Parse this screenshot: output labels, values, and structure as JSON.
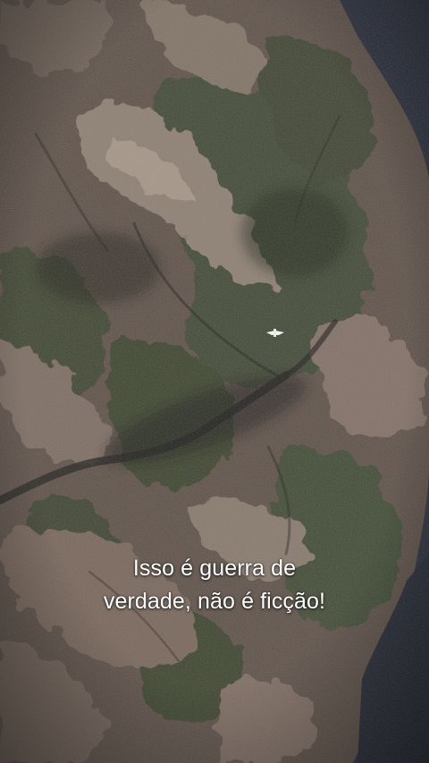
{
  "caption": {
    "line1": "Isso é guerra de",
    "line2": "verdade, não é ficção!"
  },
  "scene": {
    "subject": "aircraft-glint",
    "palette": {
      "rock": "#6b5a52",
      "rock_light": "#8a7a6e",
      "vegetation": "#3f4630",
      "vegetation_dark": "#2c3324",
      "water": "#2a2f3a",
      "shadow": "#1d1d1a"
    }
  }
}
